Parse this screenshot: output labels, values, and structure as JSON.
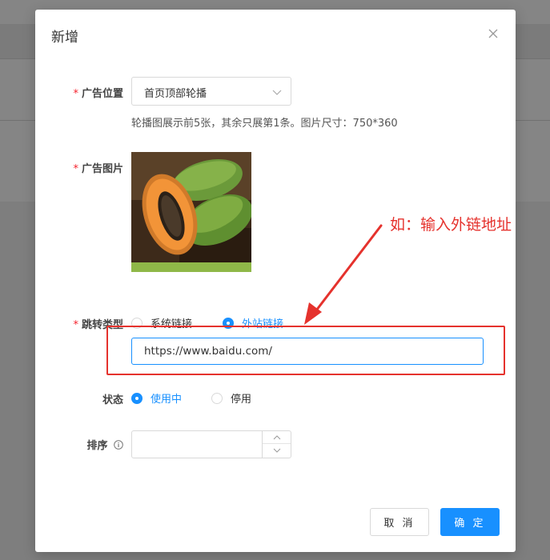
{
  "modal": {
    "title": "新增",
    "close_icon": "close-icon"
  },
  "form": {
    "ad_position": {
      "label": "广告位置",
      "required": "*",
      "value": "首页顶部轮播",
      "hint": "轮播图展示前5张，其余只展第1条。图片尺寸：750*360"
    },
    "ad_image": {
      "label": "广告图片",
      "required": "*"
    },
    "jump_type": {
      "label": "跳转类型",
      "required": "*",
      "options": [
        "系统链接",
        "外站链接"
      ],
      "selected": "外站链接",
      "url_value": "https://www.baidu.com/"
    },
    "status": {
      "label": "状态",
      "options": [
        "使用中",
        "停用"
      ],
      "selected": "使用中"
    },
    "sort": {
      "label": "排序",
      "value": ""
    }
  },
  "footer": {
    "cancel_label": "取 消",
    "ok_label": "确 定"
  },
  "annotation": {
    "text": "如：输入外链地址",
    "color": "#e5322d"
  },
  "colors": {
    "primary": "#1890ff",
    "required": "#f5222d"
  }
}
